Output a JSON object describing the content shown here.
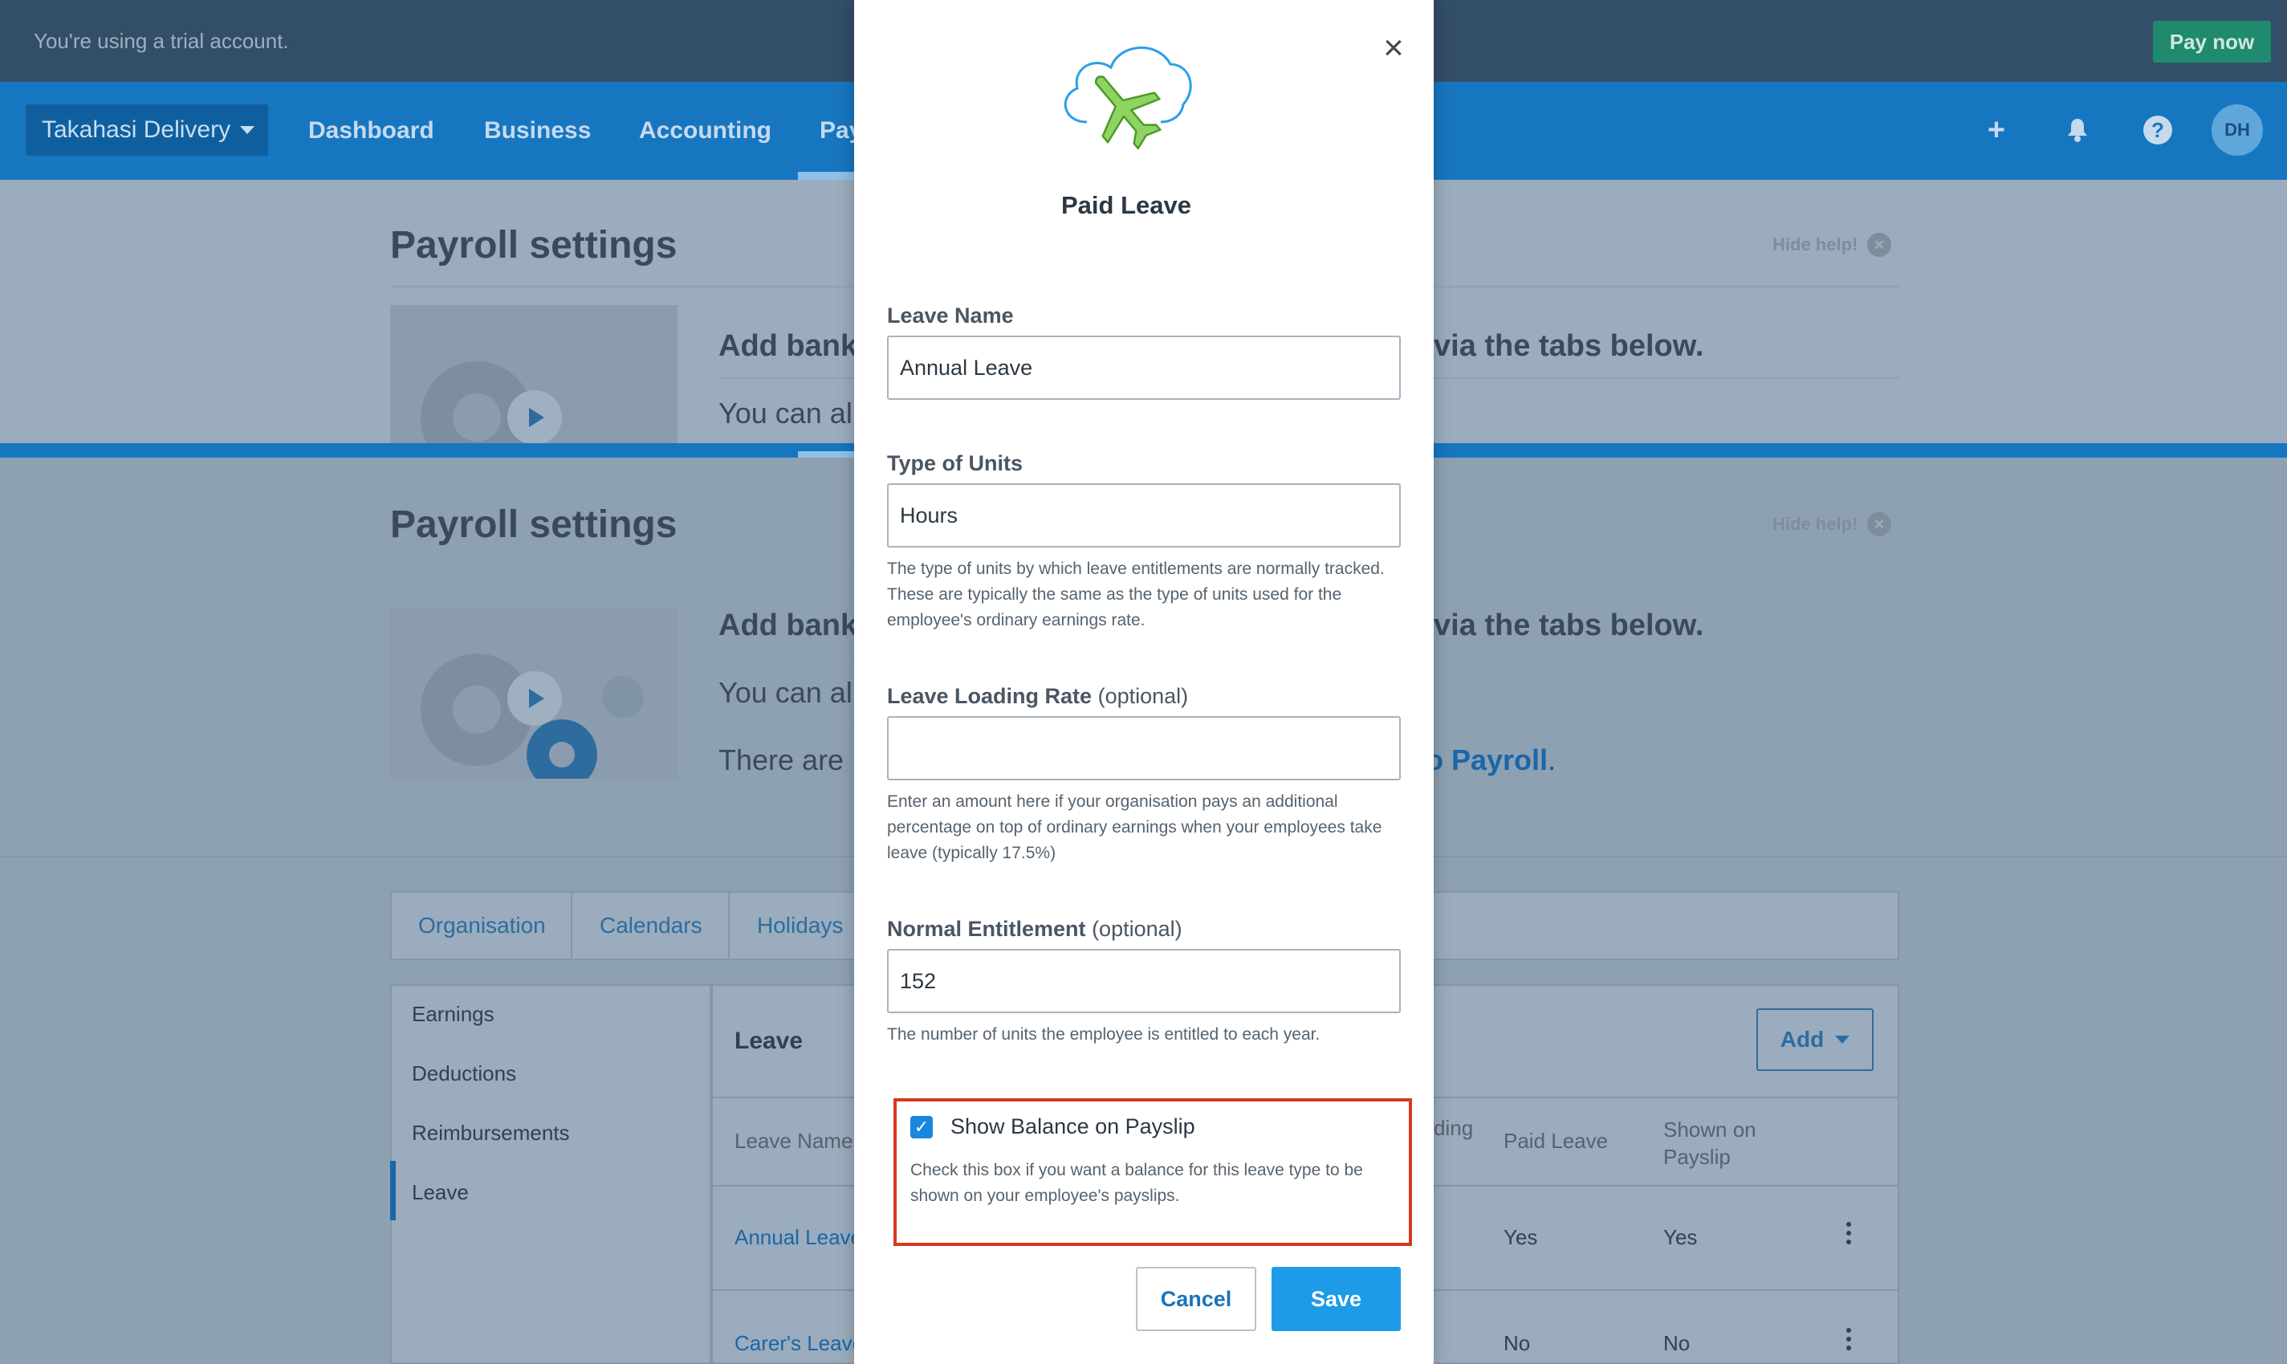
{
  "trial_bar": {
    "message": "You're using a trial account.",
    "pay_now": "Pay now"
  },
  "nav": {
    "org_name": "Takahasi Delivery",
    "links": [
      "Dashboard",
      "Business",
      "Accounting",
      "Pay"
    ],
    "avatar_initials": "DH",
    "icons": [
      "plus-icon",
      "bell-icon",
      "help-icon"
    ]
  },
  "background": {
    "page_title": "Payroll settings",
    "hide_help": "Hide help!",
    "help_heading_start": "Add bank",
    "help_heading_end": "via the tabs below.",
    "help_line1": "You can al",
    "help_line2": "There are",
    "help_link_end": "o Payroll",
    "tabs": [
      "Organisation",
      "Calendars",
      "Holidays"
    ],
    "sidebar": [
      "Earnings",
      "Deductions",
      "Reimbursements",
      "Leave"
    ],
    "panel_title": "Leave",
    "add_button": "Add",
    "table_headers": [
      "Leave Name",
      "ding",
      "Paid Leave",
      "Shown on Payslip"
    ],
    "rows": [
      {
        "name": "Annual Leave",
        "paid": "Yes",
        "shown": "Yes"
      },
      {
        "name": "Carer's Leave",
        "paid": "No",
        "shown": "No"
      }
    ]
  },
  "modal": {
    "title": "Paid Leave",
    "icon": "airplane-cloud-icon",
    "leave_name": {
      "label": "Leave Name",
      "value": "Annual Leave"
    },
    "units": {
      "label": "Type of Units",
      "value": "Hours",
      "hint": "The type of units by which leave entitlements are normally tracked. These are typically the same as the type of units used for the employee's ordinary earnings rate."
    },
    "loading": {
      "label": "Leave Loading Rate",
      "optional": "(optional)",
      "value": "",
      "hint": "Enter an amount here if your organisation pays an additional percentage on top of ordinary earnings when your employees take leave (typically 17.5%)"
    },
    "entitlement": {
      "label": "Normal Entitlement",
      "optional": "(optional)",
      "value": "152",
      "hint": "The number of units the employee is entitled to each year."
    },
    "show_balance": {
      "label": "Show Balance on Payslip",
      "checked": true,
      "hint": "Check this box if you want a balance for this leave type to be shown on your employee's payslips."
    },
    "cancel": "Cancel",
    "save": "Save"
  },
  "colors": {
    "accent": "#1e9be8",
    "nav": "#1776c0",
    "highlight": "#d43a1f"
  }
}
